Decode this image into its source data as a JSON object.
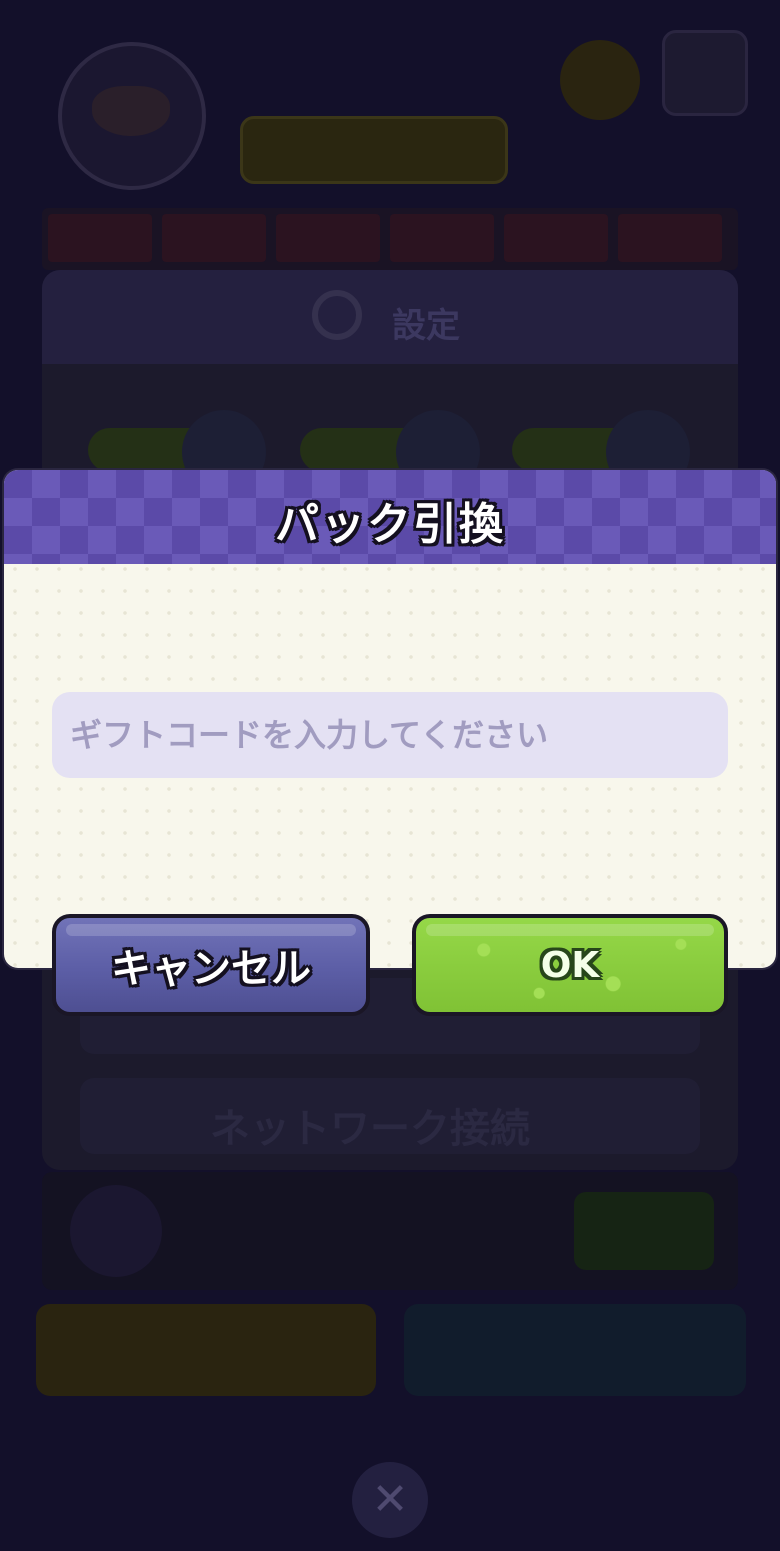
{
  "dialog": {
    "title": "パック引換",
    "input": {
      "placeholder": "ギフトコードを入力してください",
      "value": ""
    },
    "buttons": {
      "cancel_label": "キャンセル",
      "ok_label": "OK"
    }
  },
  "background": {
    "settings_title": "設定",
    "network_row_label": "ネットワーク接続",
    "close_icon": "close-icon"
  },
  "colors": {
    "header_purple": "#5b4aa8",
    "dialog_body": "#f8f7ec",
    "input_bg": "#e4e1f3",
    "cancel_button": "#5c5ea6",
    "ok_button": "#8ccd3e"
  }
}
